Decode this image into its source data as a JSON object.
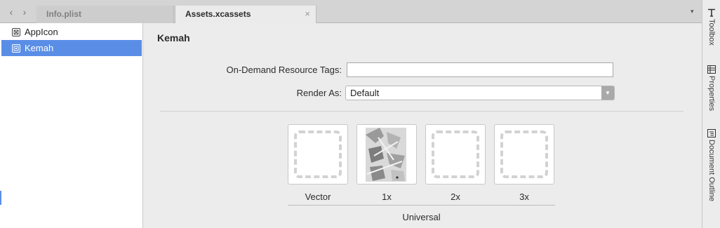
{
  "tabs": {
    "back_icon": "chevron-left",
    "forward_icon": "chevron-right",
    "items": [
      {
        "label": "Info.plist",
        "active": false
      },
      {
        "label": "Assets.xcassets",
        "active": true
      }
    ],
    "close_glyph": "×",
    "dropdown_glyph": "▾"
  },
  "sidebar": {
    "items": [
      {
        "label": "AppIcon",
        "icon": "appicon-set-icon",
        "selected": false
      },
      {
        "label": "Kemah",
        "icon": "image-set-icon",
        "selected": true
      }
    ],
    "selection_color": "#5a8ee6"
  },
  "main": {
    "title": "Kemah",
    "on_demand_label": "On-Demand Resource Tags:",
    "on_demand_value": "",
    "render_as_label": "Render As:",
    "render_as_value": "Default",
    "slots": [
      {
        "label": "Vector",
        "filled": false
      },
      {
        "label": "1x",
        "filled": true
      },
      {
        "label": "2x",
        "filled": false
      },
      {
        "label": "3x",
        "filled": false
      }
    ],
    "group_label": "Universal"
  },
  "right_panel": {
    "tabs": [
      {
        "label": "Toolbox",
        "icon": "toolbox-icon"
      },
      {
        "label": "Properties",
        "icon": "properties-icon"
      },
      {
        "label": "Document Outline",
        "icon": "document-outline-icon"
      }
    ]
  }
}
